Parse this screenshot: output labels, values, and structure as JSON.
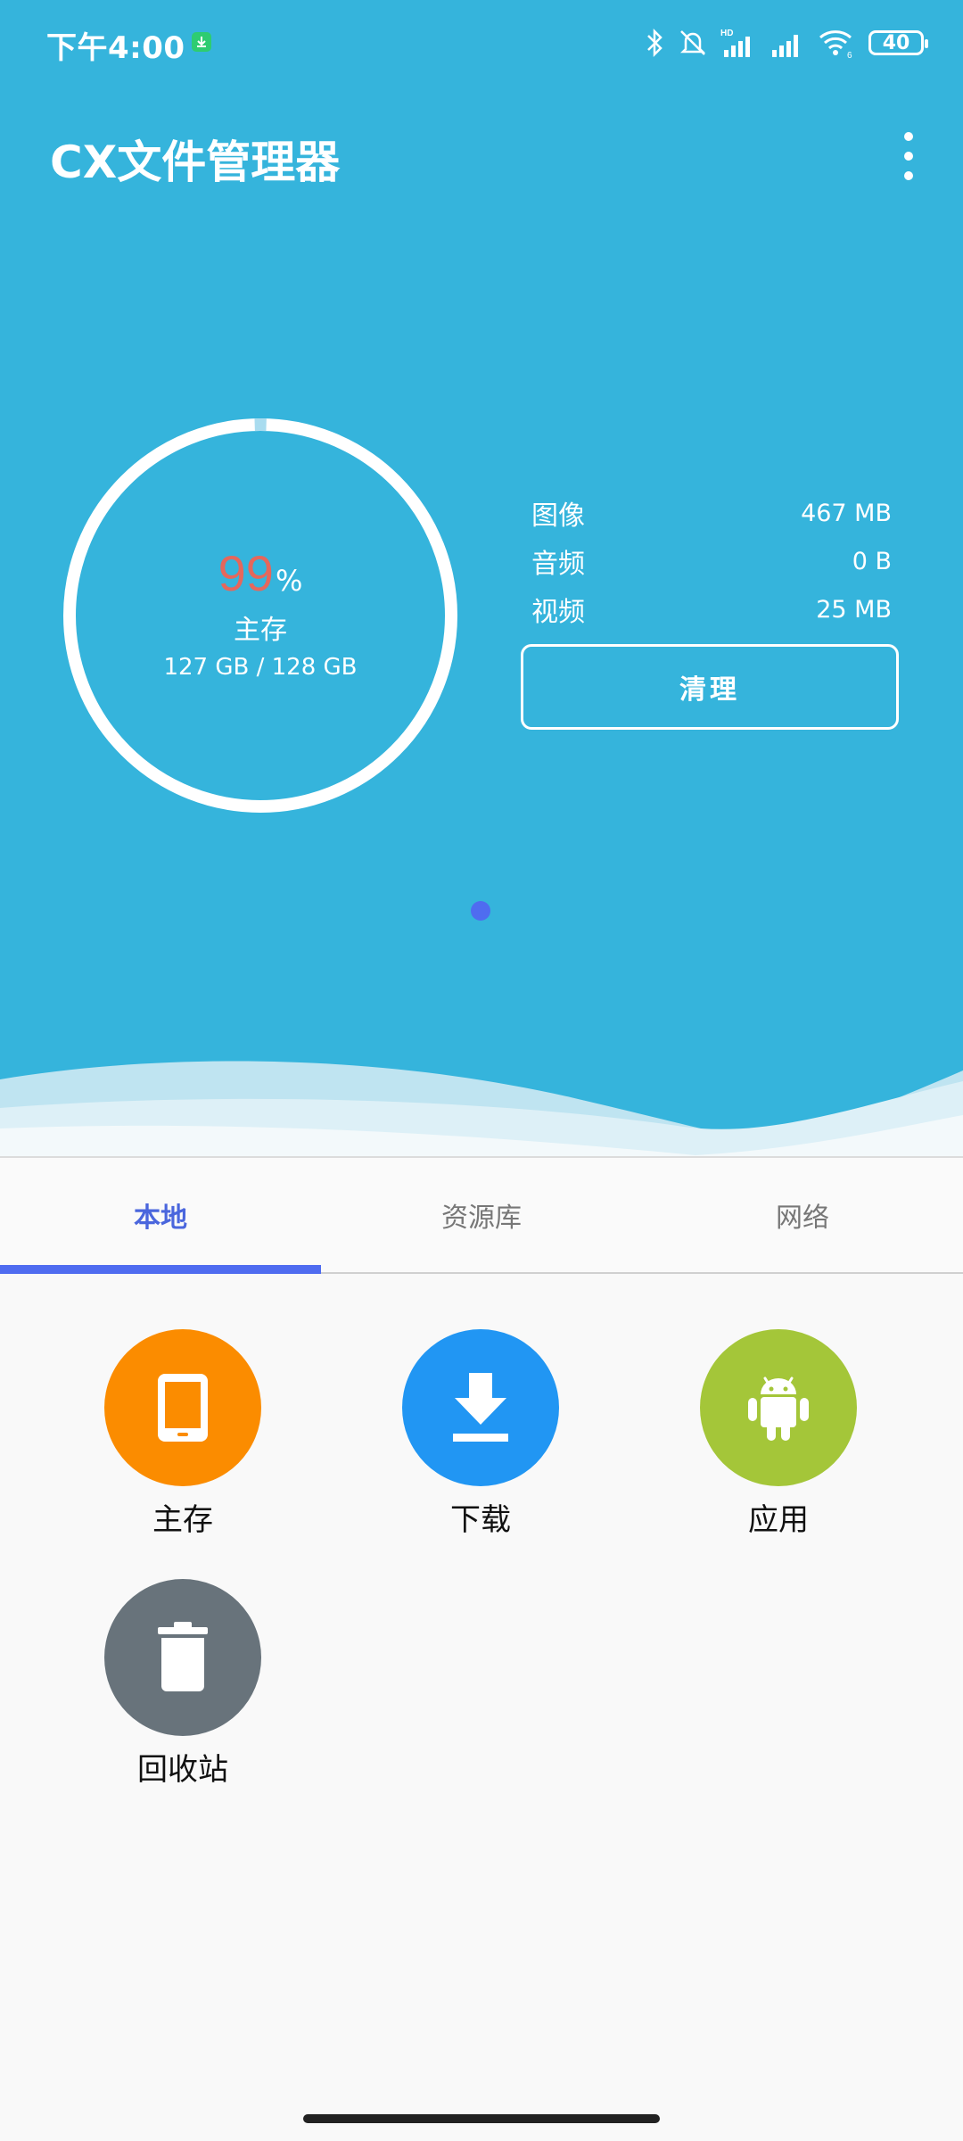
{
  "status_bar": {
    "time": "下午4:00",
    "battery": "40",
    "hd": "HD",
    "wifi_sub": "6"
  },
  "app": {
    "title": "CX文件管理器"
  },
  "storage": {
    "percent": "99",
    "percent_sign": "%",
    "used_fraction": 0.99,
    "label": "主存",
    "usage_text": "127 GB / 128 GB"
  },
  "stats": [
    {
      "label": "图像",
      "value": "467 MB"
    },
    {
      "label": "音频",
      "value": "0 B"
    },
    {
      "label": "视频",
      "value": "25 MB"
    }
  ],
  "clean_button": "清理",
  "tabs": [
    {
      "label": "本地",
      "active": true
    },
    {
      "label": "资源库",
      "active": false
    },
    {
      "label": "网络",
      "active": false
    }
  ],
  "shortcuts": [
    {
      "label": "主存",
      "color": "#fb8c00",
      "icon": "tablet-icon"
    },
    {
      "label": "下载",
      "color": "#2196f3",
      "icon": "download-icon"
    },
    {
      "label": "应用",
      "color": "#a4c639",
      "icon": "android-icon"
    },
    {
      "label": "回收站",
      "color": "#68737b",
      "icon": "trash-icon"
    }
  ],
  "colors": {
    "hero_bg": "#35b4dc",
    "accent": "#4f6cf0",
    "percent_color": "#e5675c"
  }
}
